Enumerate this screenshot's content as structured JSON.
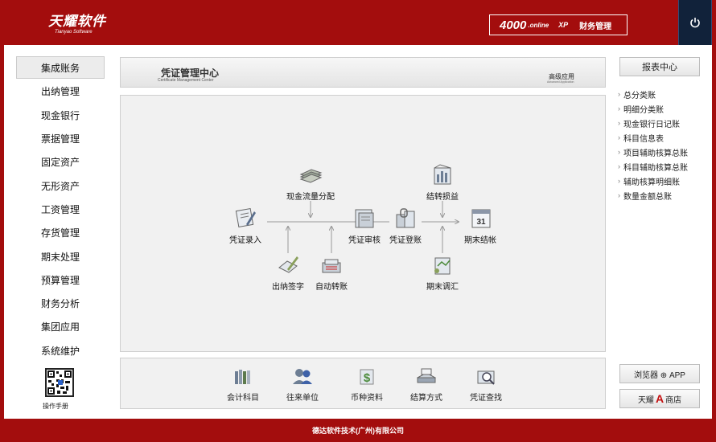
{
  "header": {
    "logo_cn": "天耀软件",
    "logo_en": "Tianyao Software",
    "product_num": "4000",
    "product_online": ".online",
    "product_xp": "XP",
    "product_name": "财务管理",
    "power_icon": "power-icon"
  },
  "left_nav": {
    "items": [
      "集成账务",
      "出纳管理",
      "现金银行",
      "票据管理",
      "固定资产",
      "无形资产",
      "工资管理",
      "存货管理",
      "期末处理",
      "预算管理",
      "财务分析",
      "集团应用",
      "系统维护"
    ],
    "active_index": 0,
    "qr_caption": "操作手册"
  },
  "center": {
    "title": "凭证管理中心",
    "subtitle": "Certificate Management Center",
    "adv_title": "高级应用",
    "adv_subtitle": "Advanced Application"
  },
  "workflow": {
    "nodes": {
      "entry": "凭证录入",
      "cashflow": "现金流量分配",
      "audit": "凭证审核",
      "post": "凭证登账",
      "closing": "期末结帐",
      "profit": "结转损益",
      "cashier_sign": "出纳签字",
      "auto_transfer": "自动转账",
      "adjust": "期末调汇"
    },
    "calendar_day": "31"
  },
  "quickbar": {
    "items": [
      "会计科目",
      "往来单位",
      "币种资料",
      "结算方式",
      "凭证查找"
    ]
  },
  "right": {
    "report_center": "报表中心",
    "reports": [
      "总分类账",
      "明细分类账",
      "现金银行日记账",
      "科目信息表",
      "项目辅助核算总账",
      "科目辅助核算总账",
      "辅助核算明细账",
      "数量金额总账"
    ],
    "browser_app": "浏览器 ⊕ APP",
    "store_prefix": "天耀",
    "store_mark": "A",
    "store_suffix": "商店"
  },
  "footer": {
    "company": "德达软件技术(广州)有限公司"
  },
  "colors": {
    "brand_red": "#a30d0d",
    "power_bg": "#11223a"
  }
}
